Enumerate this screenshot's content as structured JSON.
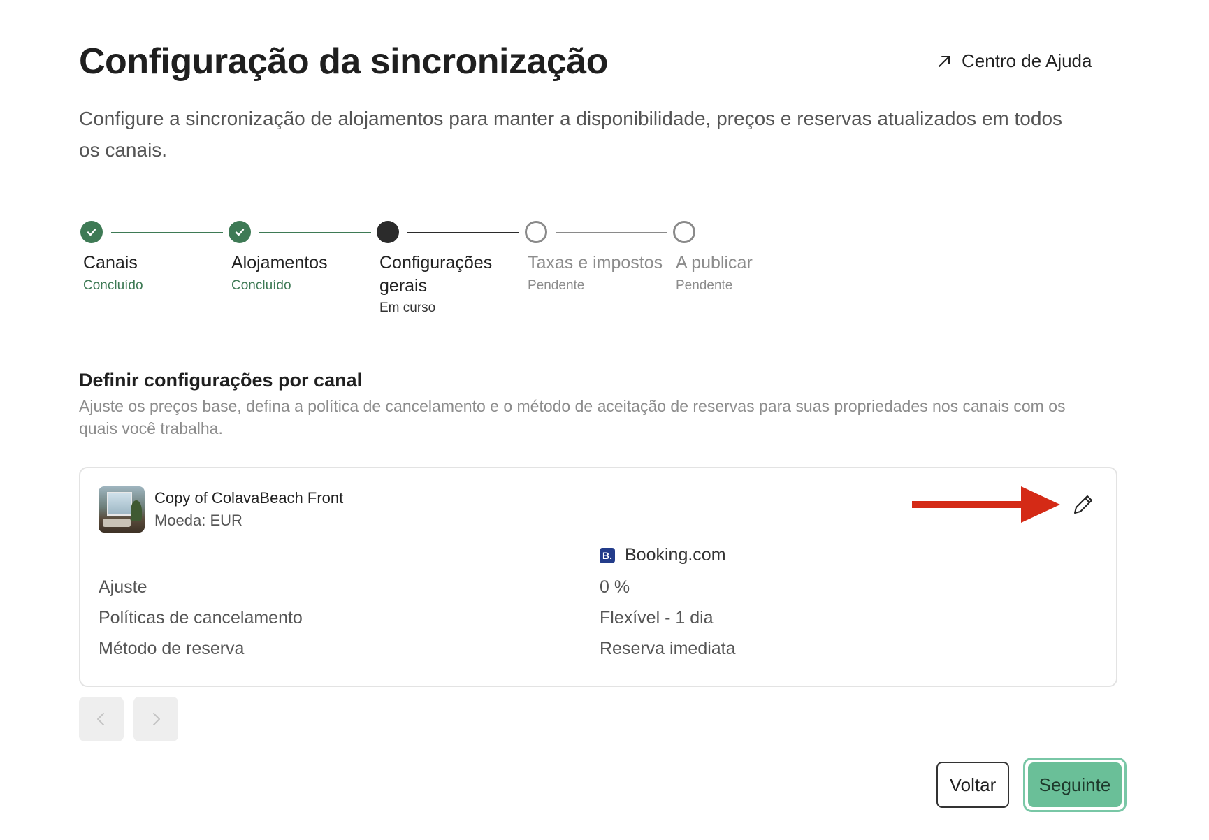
{
  "header": {
    "title": "Configuração da sincronização",
    "help_label": "Centro de Ajuda",
    "description": "Configure a sincronização de alojamentos para manter a disponibilidade, preços e reservas atualizados em todos os canais."
  },
  "stepper": {
    "steps": [
      {
        "label": "Canais",
        "status": "Concluído",
        "state": "done"
      },
      {
        "label": "Alojamentos",
        "status": "Concluído",
        "state": "done"
      },
      {
        "label": "Configurações gerais",
        "status": "Em curso",
        "state": "current"
      },
      {
        "label": "Taxas e impostos",
        "status": "Pendente",
        "state": "pending"
      },
      {
        "label": "A publicar",
        "status": "Pendente",
        "state": "pending"
      }
    ]
  },
  "section": {
    "title": "Definir configurações por canal",
    "description": "Ajuste os preços base, defina a política de cancelamento e o método de aceitação de reservas para suas propriedades nos canais com os quais você trabalha."
  },
  "property": {
    "name": "Copy of ColavaBeach Front",
    "currency": "Moeda: EUR",
    "channel": {
      "logo_text": "B.",
      "name": "Booking.com",
      "logo_color": "#233c8a"
    },
    "rows": [
      {
        "label": "Ajuste",
        "value": "0 %"
      },
      {
        "label": "Políticas de cancelamento",
        "value": "Flexível - 1 dia"
      },
      {
        "label": "Método de reserva",
        "value": "Reserva imediata"
      }
    ]
  },
  "footer": {
    "back_label": "Voltar",
    "next_label": "Seguinte"
  },
  "colors": {
    "accent_green": "#3e7a55",
    "button_green": "#6abf98",
    "annotation_arrow": "#d42a16"
  }
}
